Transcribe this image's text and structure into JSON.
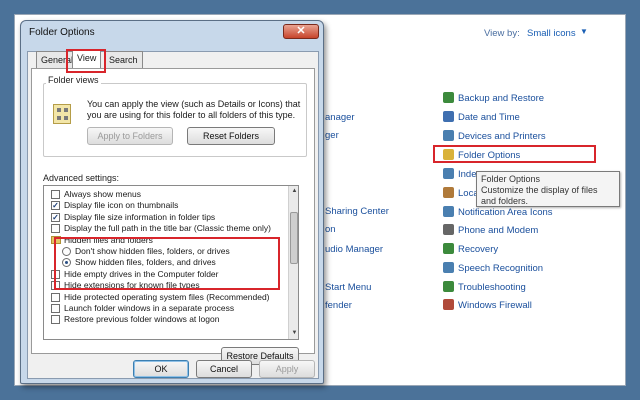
{
  "control_panel": {
    "view_by_label": "View by:",
    "view_by_value": "Small icons",
    "left_items": [
      "anager",
      "ger",
      "Sharing Center",
      "on",
      "udio Manager",
      "Start Menu",
      "fender"
    ],
    "right_items": [
      {
        "label": "Backup and Restore",
        "color": "#3c8a3c"
      },
      {
        "label": "Date and Time",
        "color": "#3f6fb0"
      },
      {
        "label": "Devices and Printers",
        "color": "#4a7fb0"
      },
      {
        "label": "Folder Options",
        "color": "#d9b23a"
      },
      {
        "label": "Inde",
        "color": "#4a7fb0"
      },
      {
        "label": "Loca",
        "color": "#b07a3a"
      },
      {
        "label": "Notification Area Icons",
        "color": "#4a7fb0"
      },
      {
        "label": "Phone and Modem",
        "color": "#666666"
      },
      {
        "label": "Recovery",
        "color": "#3c8a3c"
      },
      {
        "label": "Speech Recognition",
        "color": "#4a7fb0"
      },
      {
        "label": "Troubleshooting",
        "color": "#3c8a3c"
      },
      {
        "label": "Windows Firewall",
        "color": "#b04a3a"
      }
    ],
    "tooltip_title": "Folder Options",
    "tooltip_text": "Customize the display of files and folders."
  },
  "dialog": {
    "title": "Folder Options",
    "close_glyph": "✕",
    "tabs": [
      "General",
      "View",
      "Search"
    ],
    "folder_views": {
      "label": "Folder views",
      "text": "You can apply the view (such as Details or Icons) that you are using for this folder to all folders of this type.",
      "apply_btn": "Apply to Folders",
      "reset_btn": "Reset Folders"
    },
    "advanced": {
      "label": "Advanced settings:",
      "items": [
        {
          "type": "checkbox",
          "checked": false,
          "label": "Always show menus"
        },
        {
          "type": "checkbox",
          "checked": true,
          "label": "Display file icon on thumbnails"
        },
        {
          "type": "checkbox",
          "checked": true,
          "label": "Display file size information in folder tips"
        },
        {
          "type": "checkbox",
          "checked": false,
          "label": "Display the full path in the title bar (Classic theme only)"
        },
        {
          "type": "folder",
          "label": "Hidden files and folders"
        },
        {
          "type": "radio",
          "checked": false,
          "label": "Don't show hidden files, folders, or drives"
        },
        {
          "type": "radio",
          "checked": true,
          "label": "Show hidden files, folders, and drives"
        },
        {
          "type": "checkbox",
          "checked": false,
          "label": "Hide empty drives in the Computer folder"
        },
        {
          "type": "checkbox",
          "checked": false,
          "label": "Hide extensions for known file types"
        },
        {
          "type": "checkbox",
          "checked": false,
          "label": "Hide protected operating system files (Recommended)"
        },
        {
          "type": "checkbox",
          "checked": false,
          "label": "Launch folder windows in a separate process"
        },
        {
          "type": "checkbox",
          "checked": false,
          "label": "Restore previous folder windows at logon"
        }
      ]
    },
    "restore_defaults": "Restore Defaults",
    "ok": "OK",
    "cancel": "Cancel",
    "apply": "Apply"
  },
  "colors": {
    "highlight": "#d8252b",
    "desktop": "#4b7299",
    "link": "#1a4f9c"
  }
}
